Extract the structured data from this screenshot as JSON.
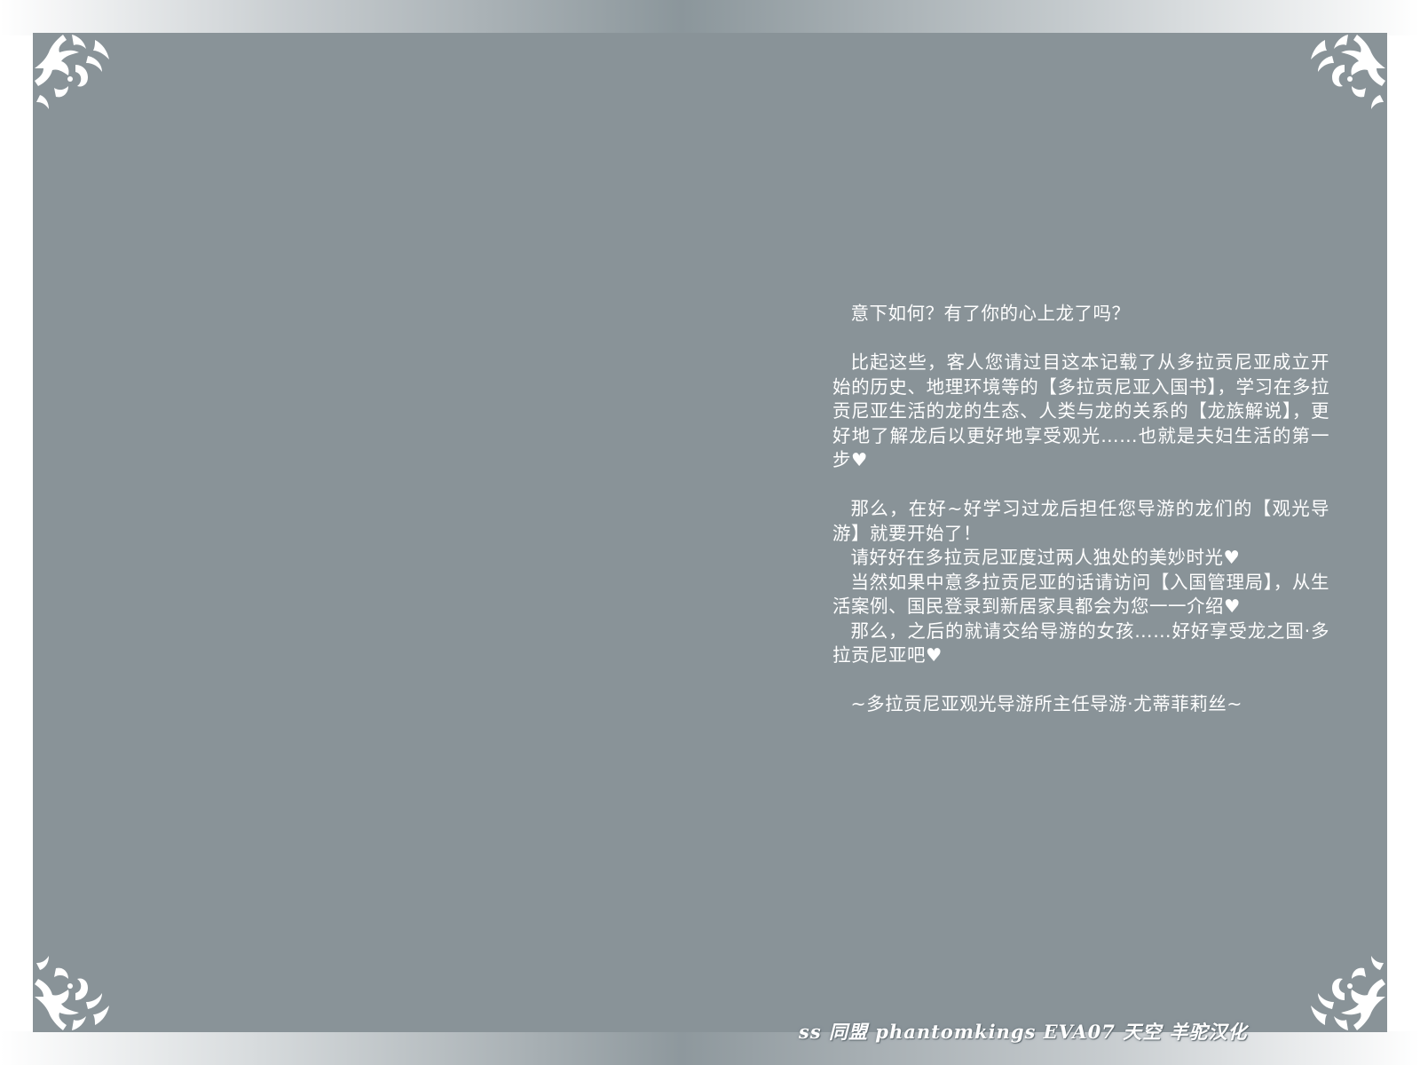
{
  "page": {
    "background_color": "#899398",
    "text_color": "#ffffff"
  },
  "decorations": {
    "corner_icon": "ornate-flourish-icon"
  },
  "body_text": {
    "p1": "意下如何？有了你的心上龙了吗？",
    "p2": "比起这些，客人您请过目这本记载了从多拉贡尼亚成立开始的历史、地理环境等的【多拉贡尼亚入国书】，学习在多拉贡尼亚生活的龙的生态、人类与龙的关系的【龙族解说】，更好地了解龙后以更好地享受观光……也就是夫妇生活的第一步♥",
    "p3": "那么，在好~好学习过龙后担任您导游的龙们的【观光导游】就要开始了！",
    "p4": "请好好在多拉贡尼亚度过两人独处的美妙时光♥",
    "p5": "当然如果中意多拉贡尼亚的话请访问【入国管理局】，从生活案例、国民登录到新居家具都会为您一一介绍♥",
    "p6": "那么，之后的就请交给导游的女孩……好好享受龙之国·多拉贡尼亚吧♥",
    "signature": "~多拉贡尼亚观光导游所主任导游·尤蒂菲莉丝~"
  },
  "credit": {
    "text": "ss 同盟 phantomkings EVA07 天空 羊驼汉化"
  }
}
